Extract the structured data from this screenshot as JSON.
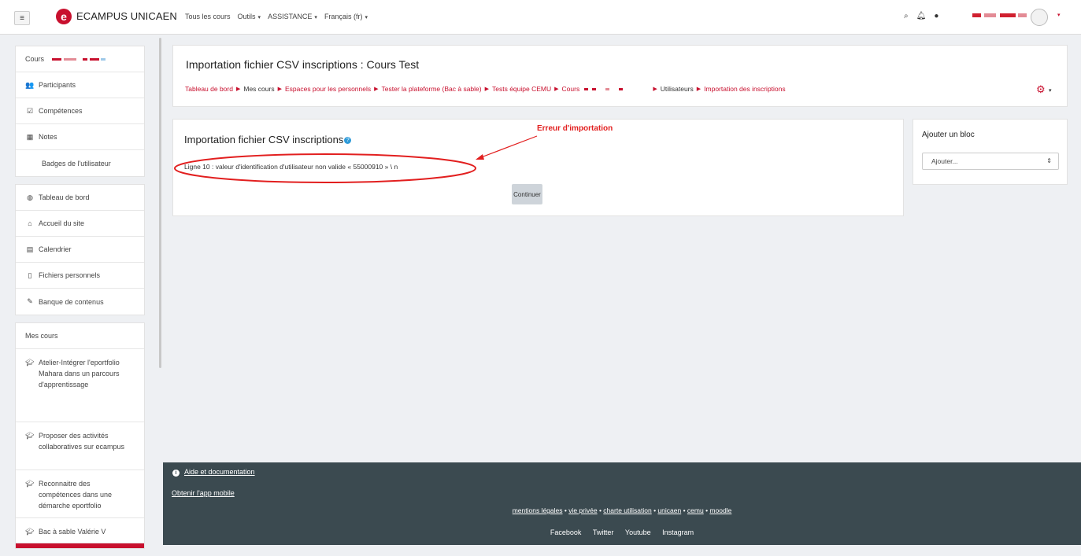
{
  "navbar": {
    "menu_icon": "hamburger-icon",
    "logo_letter": "e",
    "brand": "ECAMPUS UNICAEN",
    "items": [
      {
        "label": "Tous les cours",
        "dropdown": false
      },
      {
        "label": "Outils",
        "dropdown": true
      },
      {
        "label": "ASSISTANCE",
        "dropdown": true
      },
      {
        "label": "Français (fr)",
        "dropdown": true
      }
    ],
    "icons": [
      "search-icon",
      "bell-icon",
      "chat-icon"
    ]
  },
  "sidebar": {
    "course_label": "Cours",
    "nav1": [
      {
        "icon": "users-icon",
        "glyph": "👥",
        "label": "Participants"
      },
      {
        "icon": "check-icon",
        "glyph": "☑",
        "label": "Compétences"
      },
      {
        "icon": "table-icon",
        "glyph": "▦",
        "label": "Notes"
      },
      {
        "icon": "",
        "glyph": "",
        "label": "Badges de l'utilisateur"
      }
    ],
    "nav2": [
      {
        "icon": "dashboard-icon",
        "glyph": "◍",
        "label": "Tableau de bord"
      },
      {
        "icon": "home-icon",
        "glyph": "⌂",
        "label": "Accueil du site"
      },
      {
        "icon": "calendar-icon",
        "glyph": "▤",
        "label": "Calendrier"
      },
      {
        "icon": "file-icon",
        "glyph": "▯",
        "label": "Fichiers personnels"
      },
      {
        "icon": "pen-icon",
        "glyph": "✎",
        "label": "Banque de contenus"
      }
    ],
    "mes_cours_heading": "Mes cours",
    "courses": [
      {
        "icon": "graduation-cap-icon",
        "label": "Atelier-Intégrer l'eportfolio Mahara dans un parcours d'apprentissage"
      },
      {
        "icon": "graduation-cap-icon",
        "label": "Proposer des activités collaboratives sur ecampus"
      },
      {
        "icon": "graduation-cap-icon",
        "label": "Reconnaitre des compétences dans une démarche eportfolio"
      },
      {
        "icon": "graduation-cap-icon",
        "label": "Bac à sable Valérie V"
      }
    ]
  },
  "header": {
    "title": "Importation fichier CSV inscriptions : Cours Test",
    "breadcrumb": [
      {
        "label": "Tableau de bord",
        "link": true
      },
      {
        "label": "Mes cours",
        "link": false
      },
      {
        "label": "Espaces pour les personnels",
        "link": true
      },
      {
        "label": "Tester la plateforme (Bac à sable)",
        "link": true
      },
      {
        "label": "Tests équipe CEMU",
        "link": true
      },
      {
        "label": "Cours",
        "link": true
      },
      {
        "label": "Utilisateurs",
        "link": false
      },
      {
        "label": "Importation des inscriptions",
        "link": true
      }
    ]
  },
  "main": {
    "title": "Importation fichier CSV inscriptions",
    "error_line": "Ligne 10 : valeur d'identification d'utilisateur non valide « 55000910 » \\ n",
    "annotation": "Erreur d'importation",
    "continue_label": "Continuer"
  },
  "block": {
    "title": "Ajouter un bloc",
    "select_value": "Ajouter..."
  },
  "footer": {
    "help": "Aide et documentation",
    "mobile": "Obtenir l'app mobile",
    "links": [
      "mentions légales",
      "vie privée",
      "charte utilisation",
      "unicaen",
      "cemu",
      "moodle"
    ],
    "social": [
      "Facebook",
      "Twitter",
      "Youtube",
      "Instagram"
    ]
  },
  "colors": {
    "accent": "#c8102e",
    "annotation": "#e21f1f",
    "footer_bg": "#3b4a50",
    "help_blue": "#2f9bd9"
  }
}
